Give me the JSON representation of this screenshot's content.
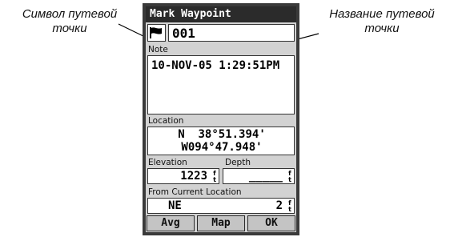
{
  "annotations": {
    "left": [
      "Символ путевой",
      "точки"
    ],
    "right": [
      "Название путевой",
      "точки"
    ]
  },
  "window": {
    "title": "Mark Waypoint"
  },
  "waypoint": {
    "symbol_icon": "flag-icon",
    "name": "001"
  },
  "note": {
    "label": "Note",
    "value": "10-NOV-05 1:29:51PM"
  },
  "location": {
    "label": "Location",
    "lat": "N  38°51.394'",
    "lon": "W094°47.948'"
  },
  "elevation": {
    "label": "Elevation",
    "value": "1223",
    "unit_top": "f",
    "unit_bottom": "t"
  },
  "depth": {
    "label": "Depth",
    "value": "_____",
    "unit_top": "f",
    "unit_bottom": "t"
  },
  "from_current": {
    "label": "From Current Location",
    "direction": "NE",
    "distance": "2",
    "unit_top": "f",
    "unit_bottom": "t"
  },
  "buttons": {
    "avg": "Avg",
    "map": "Map",
    "ok": "OK"
  },
  "colors": {
    "titlebar": "#2b2b2b",
    "screen": "#d2d2d2",
    "field": "#ffffff"
  }
}
